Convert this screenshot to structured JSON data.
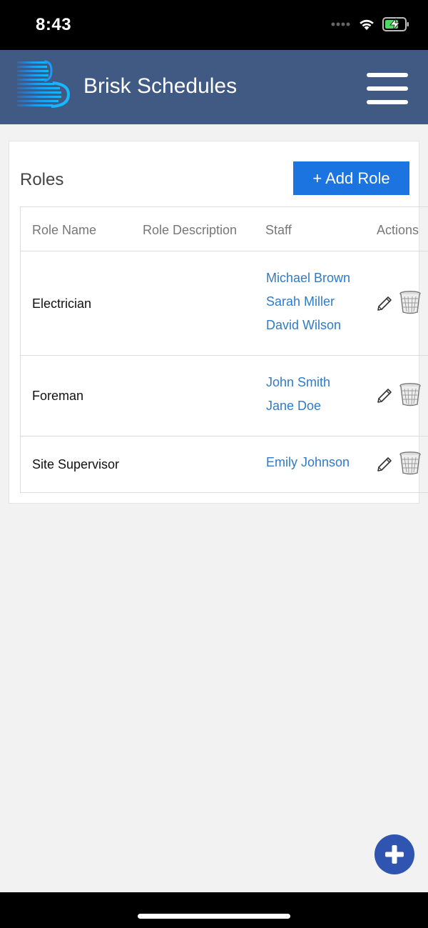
{
  "status_bar": {
    "time": "8:43",
    "icons": [
      "signal-dots-icon",
      "wifi-icon",
      "battery-charging-icon"
    ]
  },
  "header": {
    "title": "Brisk Schedules",
    "logo_icon": "brisk-b-logo",
    "menu_icon": "hamburger-menu-icon",
    "background_color": "#415a84"
  },
  "roles_card": {
    "title": "Roles",
    "add_button_label": "+ Add Role",
    "accent_color": "#1c74e0"
  },
  "table": {
    "headers": [
      "Role Name",
      "Role Description",
      "Staff",
      "Actions"
    ],
    "rows": [
      {
        "role": "Electrician",
        "description": "",
        "staff": [
          "Michael Brown",
          "Sarah Miller",
          "David Wilson"
        ]
      },
      {
        "role": "Foreman",
        "description": "",
        "staff": [
          "John Smith",
          "Jane Doe"
        ]
      },
      {
        "role": "Site Supervisor",
        "description": "",
        "staff": [
          "Emily Johnson"
        ]
      }
    ],
    "action_icons": [
      "pencil-edit-icon",
      "trash-can-icon"
    ],
    "link_color": "#2f7bc6"
  },
  "fab": {
    "icon": "plus-icon",
    "color": "#2f55b0"
  }
}
